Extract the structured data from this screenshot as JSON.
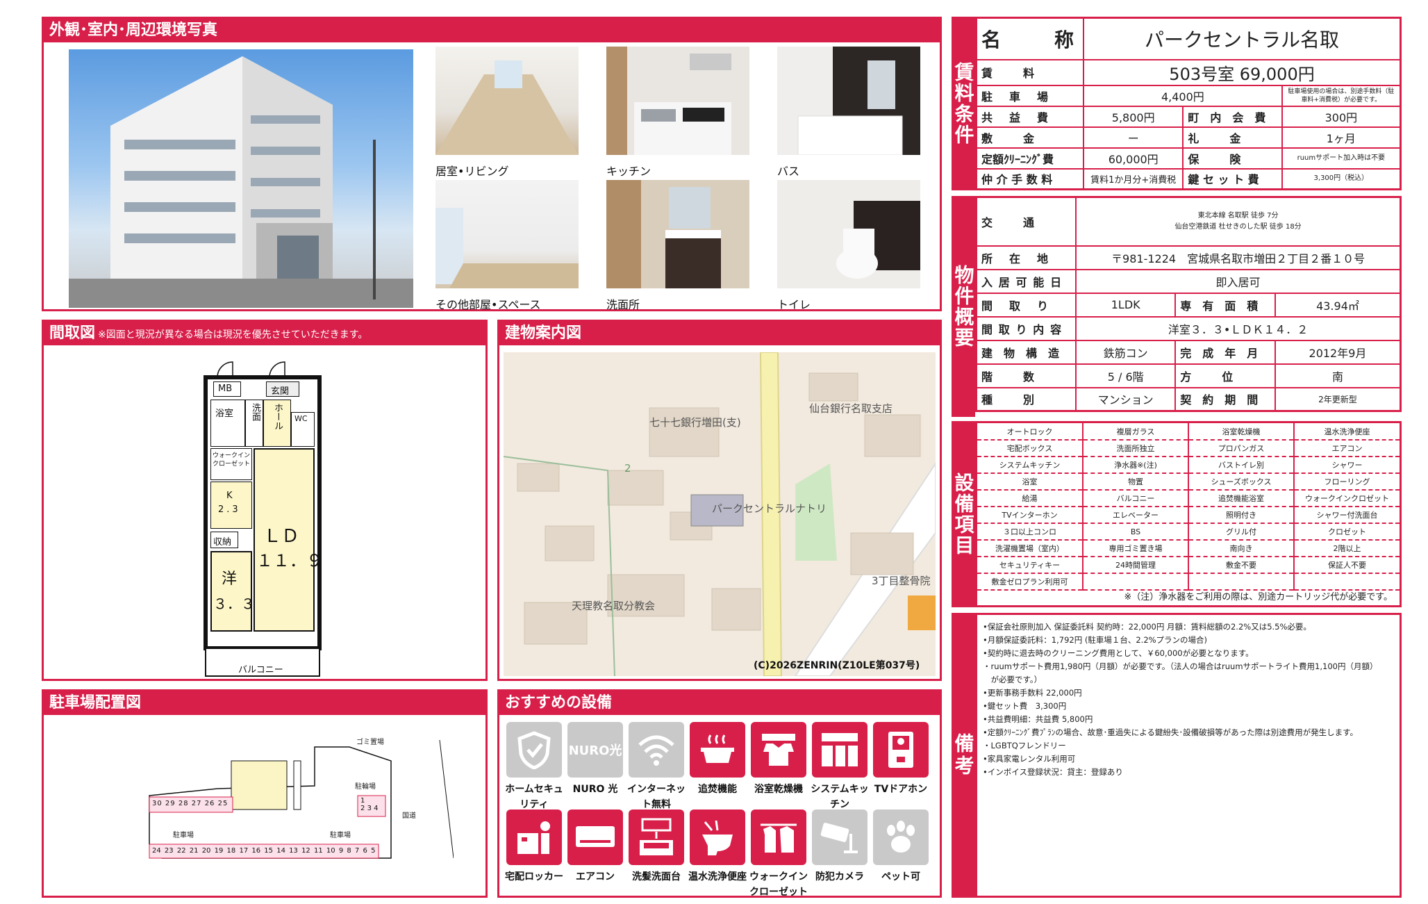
{
  "sections": {
    "photos_title": "外観･室内･周辺環境写真",
    "floorplan_title": "間取図",
    "floorplan_note": "※図面と現況が異なる場合は現況を優先させていただきます。",
    "map_title": "建物案内図",
    "parking_title": "駐車場配置図",
    "features_title": "おすすめの設備"
  },
  "photos": [
    {
      "caption": "居室•リビング"
    },
    {
      "caption": "キッチン"
    },
    {
      "caption": "バス"
    },
    {
      "caption": "その他部屋•スペース"
    },
    {
      "caption": "洗面所"
    },
    {
      "caption": "トイレ"
    }
  ],
  "floorplan": {
    "mb": "MB",
    "entrance": "玄関",
    "bath": "浴室",
    "washroom": "洗面",
    "hall": "ホール",
    "wc": "WC",
    "walkin": "ウォークインクローゼット",
    "kitchen": "K",
    "kitchen_size": "2.3",
    "storage": "収納",
    "ld": "ＬＤ",
    "ld_size": "１１．９",
    "western": "洋",
    "western_size": "３．３",
    "balcony": "バルコニー"
  },
  "map": {
    "labels": [
      "七十七銀行増田(支)",
      "仙台銀行名取支店",
      "パークセントラルナトリ",
      "3丁目整骨院",
      "天理教名取分教会",
      "2"
    ],
    "copyright": "(C)2026ZENRIN(Z10LE第037号)"
  },
  "parking": {
    "garbage": "ゴミ置場",
    "bike": "駐輪場",
    "road": "国道",
    "lot": "駐車場",
    "lot2": "駐車場",
    "top_numbers": [
      "30",
      "29",
      "28",
      "27",
      "26",
      "25"
    ],
    "right_numbers": [
      "1",
      "2",
      "3",
      "4"
    ],
    "bottom_numbers": [
      "24",
      "23",
      "22",
      "21",
      "20",
      "19",
      "18",
      "17",
      "16",
      "15",
      "14",
      "13",
      "12",
      "11",
      "10",
      "9",
      "8",
      "7",
      "6",
      "5"
    ]
  },
  "features": [
    {
      "label": "ホームセキュリティ",
      "icon": "shield-icon",
      "active": false
    },
    {
      "label": "NURO 光",
      "icon": "nuro-icon",
      "active": false
    },
    {
      "label": "インターネット無料",
      "icon": "wifi-icon",
      "active": false
    },
    {
      "label": "追焚機能",
      "icon": "bathtub-icon",
      "active": true
    },
    {
      "label": "浴室乾燥機",
      "icon": "dryer-icon",
      "active": true
    },
    {
      "label": "システムキッチン",
      "icon": "kitchen-icon",
      "active": true
    },
    {
      "label": "TVドアホン",
      "icon": "intercom-icon",
      "active": true
    },
    {
      "label": "宅配ロッカー",
      "icon": "locker-icon",
      "active": true
    },
    {
      "label": "エアコン",
      "icon": "aircon-icon",
      "active": true
    },
    {
      "label": "洗髪洗面台",
      "icon": "washbasin-icon",
      "active": true
    },
    {
      "label": "温水洗浄便座",
      "icon": "toilet-icon",
      "active": true
    },
    {
      "label": "ウォークインクローゼット",
      "icon": "closet-icon",
      "active": true
    },
    {
      "label": "防犯カメラ",
      "icon": "camera-icon",
      "active": false
    },
    {
      "label": "ペット可",
      "icon": "paw-icon",
      "active": false
    }
  ],
  "rent_section_label": "賃料条件",
  "rent": {
    "name_label": "名　　称",
    "name": "パークセントラル名取",
    "rent_label": "賃　　料",
    "rent": "503号室 69,000円",
    "parking_label": "駐　車　場",
    "parking": "4,400円",
    "parking_note": "駐車場使用の場合は、別途手数料（駐車料+消費税）が必要です。",
    "common_label": "共　益　費",
    "common": "5,800円",
    "town_label": "町　内　会　費",
    "town": "300円",
    "deposit_label": "敷　　金",
    "deposit": "ー",
    "key_money_label": "礼　　金",
    "key_money": "1ヶ月",
    "cleaning_label": "定額ｸﾘｰﾆﾝｸﾞ費",
    "cleaning": "60,000円",
    "insurance_label": "保　　険",
    "insurance": "ruumサポート加入時は不要",
    "brokerage_label": "仲 介 手 数 料",
    "brokerage": "賃料1か月分+消費税",
    "keyset_label": "鍵 セ ッ ト 費",
    "keyset": "3,300円（税込）"
  },
  "overview_section_label": "物件概要",
  "overview": {
    "transport_label": "交　　通",
    "transport_1": "東北本線 名取駅 徒歩 7分",
    "transport_2": "仙台空港鉄道 杜せきのした駅 徒歩 18分",
    "address_label": "所　在　地",
    "address": "〒981-1224　宮城県名取市増田２丁目２番１０号",
    "movein_label": "入 居 可 能 日",
    "movein": "即入居可",
    "layout_label": "間　取　り",
    "layout": "1LDK",
    "area_label": "専　有　面　積",
    "area": "43.94㎡",
    "layout_detail_label": "間 取 り 内 容",
    "layout_detail": "洋室３．３•ＬＤＫ１４．２",
    "structure_label": "建　物　構　造",
    "structure": "鉄筋コン",
    "completed_label": "完　成　年　月",
    "completed": "2012年9月",
    "floors_label": "階　　数",
    "floors": "5 / 6階",
    "direction_label": "方　　位",
    "direction": "南",
    "type_label": "種　　別",
    "type": "マンション",
    "contract_label": "契　約　期　間",
    "contract": "2年更新型"
  },
  "equipment_section_label": "設備項目",
  "equipment": [
    [
      "オートロック",
      "複層ガラス",
      "浴室乾燥機",
      "温水洗浄便座"
    ],
    [
      "宅配ボックス",
      "洗面所独立",
      "プロパンガス",
      "エアコン"
    ],
    [
      "システムキッチン",
      "浄水器※(注)",
      "バストイレ別",
      "シャワー"
    ],
    [
      "浴室",
      "物置",
      "シューズボックス",
      "フローリング"
    ],
    [
      "給湯",
      "バルコニー",
      "追焚機能浴室",
      "ウォークインクロゼット"
    ],
    [
      "TVインターホン",
      "エレベーター",
      "照明付き",
      "シャワー付洗面台"
    ],
    [
      "３口以上コンロ",
      "BS",
      "グリル付",
      "クロゼット"
    ],
    [
      "洗濯機置場（室内）",
      "専用ゴミ置き場",
      "南向き",
      "2階以上"
    ],
    [
      "セキュリティキー",
      "24時間管理",
      "敷金不要",
      "保証人不要"
    ],
    [
      "敷金ゼロプラン利用可",
      "",
      "",
      ""
    ]
  ],
  "equipment_note": "※（注）浄水器をご利用の際は、別途カートリッジ代が必要です。",
  "remarks_section_label": "備考",
  "remarks": [
    "•保証会社原則加入 保証委託料 契約時：22,000円 月額：賃料総額の2.2%又は5.5%必要。",
    "•月額保証委託料：1,792円 (駐車場１台、2.2%プランの場合)",
    "•契約時に退去時のクリーニング費用として、￥60,000が必要となります。",
    "・ruumサポート費用1,980円（月額）が必要です。（法人の場合はruumサポートライト費用1,100円（月額）",
    "　が必要です。）",
    "•更新事務手数料 22,000円",
    "•鍵セット費　3,300円",
    "•共益費明細：共益費 5,800円",
    "•定額ｸﾘｰﾆﾝｸﾞ費ﾌﾟﾗﾝの場合、故意･重過失による鍵紛失･設備破損等があった際は別途費用が発生します。",
    "・LGBTQフレンドリー",
    "•家具家電レンタル利用可",
    "•インボイス登録状況：貸主：登録あり"
  ]
}
